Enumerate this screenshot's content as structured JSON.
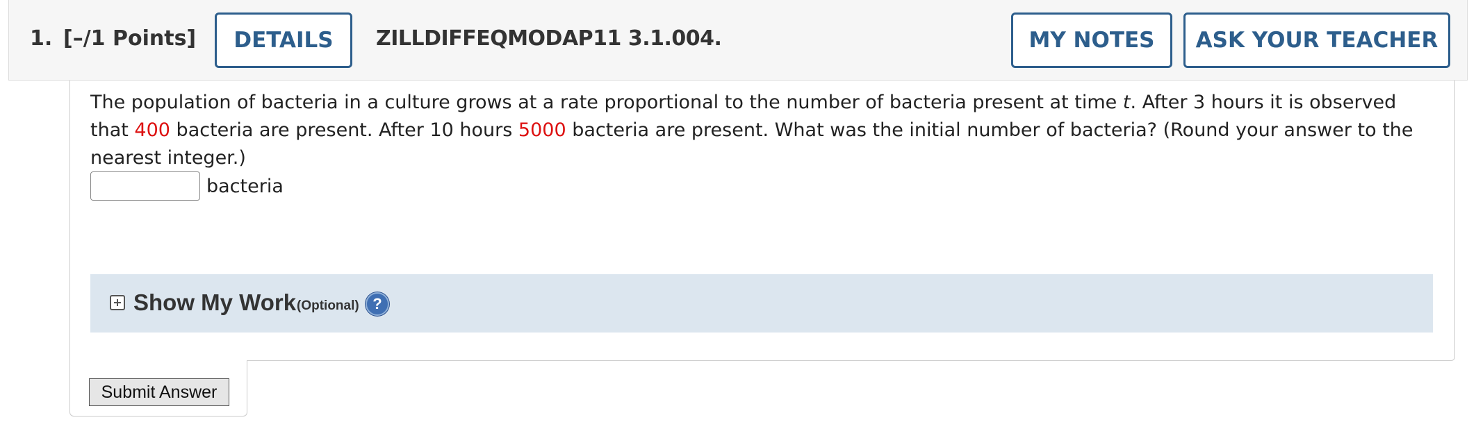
{
  "header": {
    "question_number": "1.",
    "points": "[–/1 Points]",
    "details_label": "DETAILS",
    "question_code": "ZILLDIFFEQMODAP11 3.1.004.",
    "my_notes_label": "MY NOTES",
    "ask_teacher_label": "ASK YOUR TEACHER"
  },
  "question": {
    "text_part1": "The population of bacteria in a culture grows at a rate proportional to the number of bacteria present at time ",
    "variable": "t",
    "text_part2": ". After 3 hours it is observed that ",
    "value1": "400",
    "text_part3": " bacteria are present. After 10 hours ",
    "value2": "5000",
    "text_part4": " bacteria are present. What was the initial number of bacteria? (Round your answer to the nearest integer.)"
  },
  "answer": {
    "value": "",
    "unit": "bacteria"
  },
  "show_my_work": {
    "title": "Show My Work",
    "optional_label": "(Optional)",
    "help_symbol": "?",
    "toggle_icon": "plus-box-icon",
    "help_icon": "question-circle-icon"
  },
  "submit": {
    "label": "Submit Answer"
  },
  "colors": {
    "accent": "#2d5e8c",
    "highlight_red": "#dd1111",
    "work_panel_bg": "#dce6ef",
    "header_bg": "#f6f6f6"
  }
}
